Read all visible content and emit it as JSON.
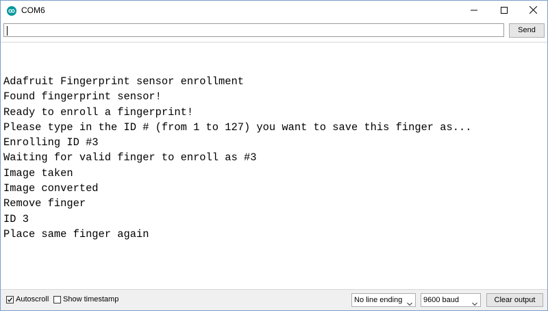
{
  "window": {
    "title": "COM6",
    "icon": "arduino-icon",
    "controls": [
      "minimize-icon",
      "maximize-icon",
      "close-icon"
    ]
  },
  "send_bar": {
    "input_value": "",
    "send_label": "Send"
  },
  "output": {
    "lines": [
      "Adafruit Fingerprint sensor enrollment",
      "Found fingerprint sensor!",
      "Ready to enroll a fingerprint!",
      "Please type in the ID # (from 1 to 127) you want to save this finger as...",
      "Enrolling ID #3",
      "Waiting for valid finger to enroll as #3",
      "Image taken",
      "Image converted",
      "Remove finger",
      "ID 3",
      "Place same finger again"
    ]
  },
  "bottom_bar": {
    "autoscroll": {
      "label": "Autoscroll",
      "checked": true
    },
    "timestamp": {
      "label": "Show timestamp",
      "checked": false
    },
    "line_ending": {
      "selected": "No line ending"
    },
    "baud": {
      "selected": "9600 baud"
    },
    "clear_label": "Clear output"
  },
  "colors": {
    "accent": "#00979c",
    "window_border": "#7a9cc9",
    "button_bg": "#e6e6e6",
    "footer_bg": "#f0f0f0"
  }
}
